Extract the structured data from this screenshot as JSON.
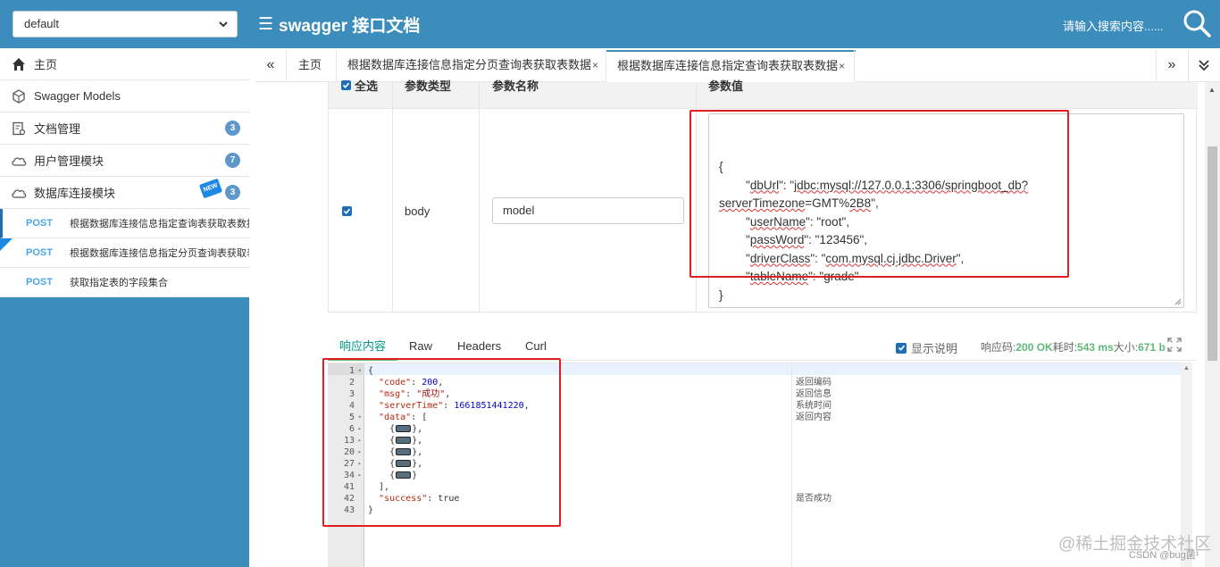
{
  "header": {
    "group_select": "default",
    "title": "swagger 接口文档",
    "search_placeholder": "请输入搜索内容......"
  },
  "sidebar": {
    "items": [
      {
        "label": "主页",
        "icon": "home-icon"
      },
      {
        "label": "Swagger Models",
        "icon": "models-icon"
      },
      {
        "label": "文档管理",
        "icon": "doc-manage-icon",
        "badge": "3"
      },
      {
        "label": "用户管理模块",
        "icon": "cloud-icon",
        "badge": "7"
      },
      {
        "label": "数据库连接模块",
        "icon": "cloud-icon",
        "badge": "3",
        "new": "NEW"
      }
    ],
    "apis": [
      {
        "method": "POST",
        "label": "根据数据库连接信息指定查询表获取表数据"
      },
      {
        "method": "POST",
        "label": "根据数据库连接信息指定分页查询表获取表数据"
      },
      {
        "method": "POST",
        "label": "获取指定表的字段集合"
      }
    ]
  },
  "tabs": {
    "prev": "«",
    "next": "»",
    "items": [
      {
        "label": "主页"
      },
      {
        "label": "根据数据库连接信息指定分页查询表获取表数据",
        "close": "×"
      },
      {
        "label": "根据数据库连接信息指定查询表获取表数据",
        "close": "×"
      }
    ]
  },
  "params": {
    "headers": [
      "全选",
      "参数类型",
      "参数名称",
      "参数值"
    ],
    "row": {
      "checked": true,
      "type": "body",
      "name": "model"
    },
    "json_lines": [
      {
        "pre": "{",
        "parts": []
      },
      {
        "pre": "        \"",
        "key": "dbUrl",
        "mid": "\": \"",
        "val": "jdbc:mysql://127.0.0.1:3306/springboot_db?",
        "post": ""
      },
      {
        "pre": "",
        "key": "serverTimezone",
        "mid": "=GMT%",
        "val": "2B8",
        "post": "\","
      },
      {
        "pre": "        \"",
        "key": "userName",
        "mid": "\": \"root\",",
        "val": "",
        "post": ""
      },
      {
        "pre": "        \"",
        "key": "passWord",
        "mid": "\": \"123456\",",
        "val": "",
        "post": ""
      },
      {
        "pre": "        \"",
        "key": "driverClass",
        "mid": "\": \"",
        "val": "com.mysql.cj.jdbc.Driver",
        "post": "\","
      },
      {
        "pre": "        \"",
        "key": "tableName",
        "mid": "\": \"grade\"",
        "val": "",
        "post": ""
      },
      {
        "pre": "}",
        "parts": []
      }
    ]
  },
  "response": {
    "tabs": [
      "响应内容",
      "Raw",
      "Headers",
      "Curl"
    ],
    "show_desc": "显示说明",
    "code_label": "响应码:",
    "code_value": "200 OK",
    "time_label": "耗时:",
    "time_value": "543 ms",
    "size_label": "大小:",
    "size_value": "671 b",
    "lines": [
      {
        "n": "1",
        "fold": "▾",
        "text": "{"
      },
      {
        "n": "2",
        "text": "  \"code\": 200,",
        "comment": "返回编码"
      },
      {
        "n": "3",
        "text": "  \"msg\": \"成功\",",
        "comment": "返回信息"
      },
      {
        "n": "4",
        "text": "  \"serverTime\": 1661851441220,",
        "comment": "系统时间"
      },
      {
        "n": "5",
        "fold": "▾",
        "text": "  \"data\": [",
        "comment": "返回内容"
      },
      {
        "n": "6",
        "fold": "▸",
        "text": "    {▢},"
      },
      {
        "n": "13",
        "fold": "▸",
        "text": "    {▢},"
      },
      {
        "n": "20",
        "fold": "▸",
        "text": "    {▢},"
      },
      {
        "n": "27",
        "fold": "▸",
        "text": "    {▢},"
      },
      {
        "n": "34",
        "fold": "▸",
        "text": "    {▢}"
      },
      {
        "n": "41",
        "text": "  ],"
      },
      {
        "n": "42",
        "text": "  \"success\": true",
        "comment": "是否成功"
      },
      {
        "n": "43",
        "text": "}"
      }
    ]
  },
  "watermark": "@稀土掘金技术社区",
  "watermark_small": "CSDN @bug菌¹",
  "colors": {
    "header_bg": "#3c8dbc",
    "accent_green": "#5fb878",
    "badge": "#5e97c9",
    "highlight_red": "#e02020"
  }
}
